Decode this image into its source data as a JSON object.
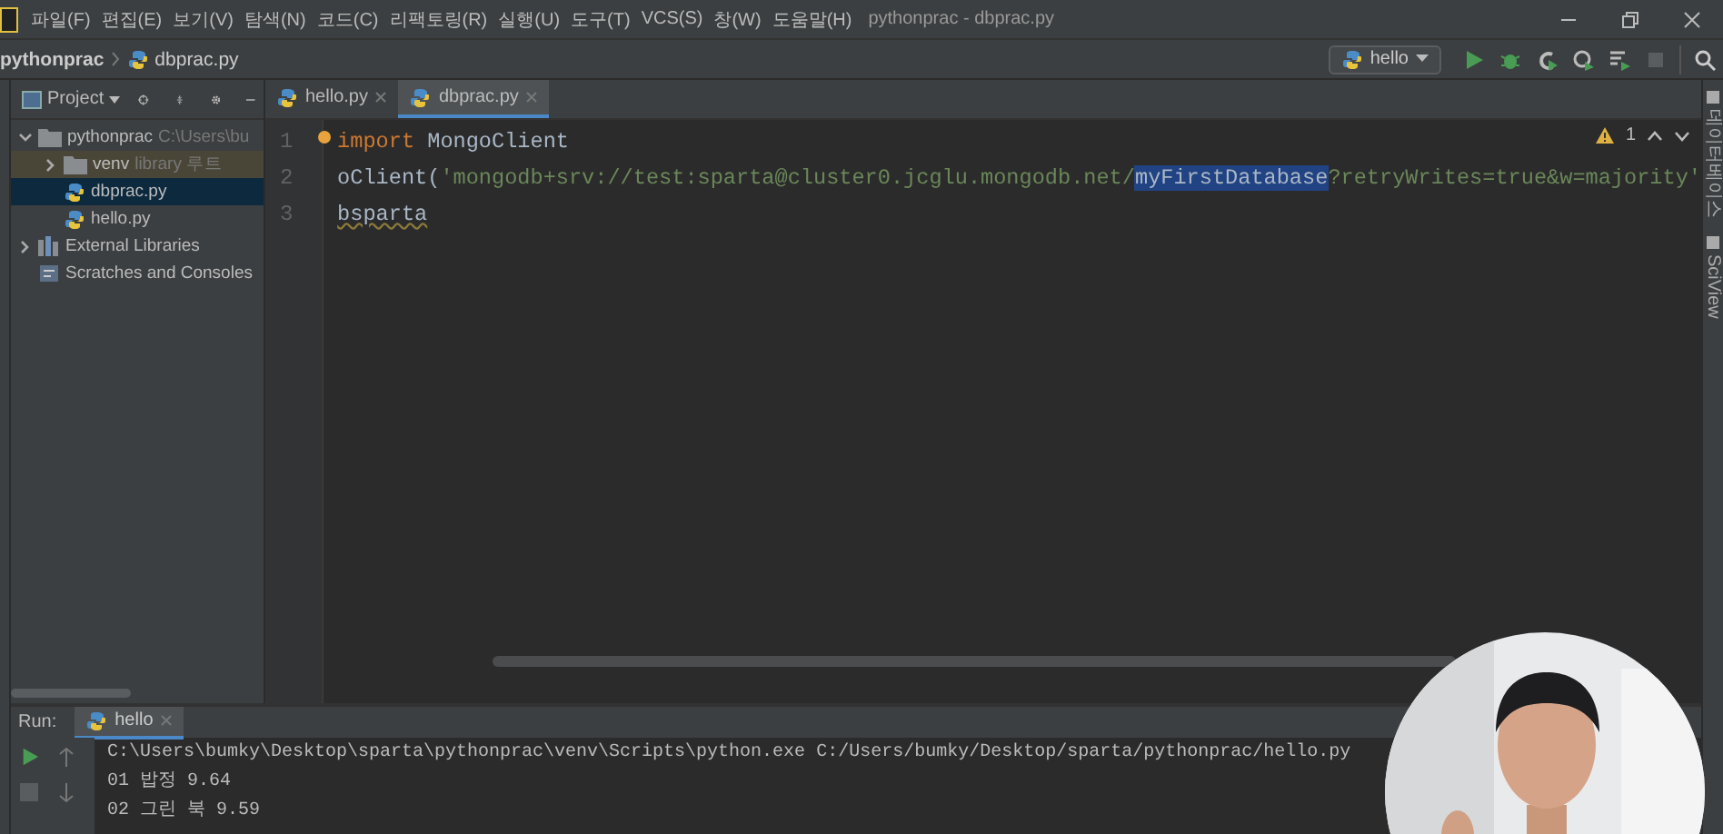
{
  "window": {
    "title": "pythonprac - dbprac.py"
  },
  "menu": [
    "파일(F)",
    "편집(E)",
    "보기(V)",
    "탐색(N)",
    "코드(C)",
    "리팩토링(R)",
    "실행(U)",
    "도구(T)",
    "VCS(S)",
    "창(W)",
    "도움말(H)"
  ],
  "breadcrumb": [
    {
      "label": "pythonprac",
      "kind": "folder"
    },
    {
      "label": "dbprac.py",
      "kind": "file"
    }
  ],
  "run_config": {
    "label": "hello"
  },
  "project_panel": {
    "label": "Project"
  },
  "tree": [
    {
      "label": "pythonprac",
      "hint": "C:\\Users\\bu",
      "kind": "folder",
      "expanded": true,
      "selected": false,
      "children": [
        {
          "label": "venv",
          "hint": "library 루트",
          "kind": "folder",
          "expanded": false,
          "selected": false,
          "highlighted": true
        },
        {
          "label": "dbprac.py",
          "kind": "file",
          "selected": true
        },
        {
          "label": "hello.py",
          "kind": "file",
          "selected": false
        }
      ]
    },
    {
      "label": "External Libraries",
      "kind": "library",
      "expanded": false,
      "selected": false
    },
    {
      "label": "Scratches and Consoles",
      "kind": "scratch",
      "selected": false
    }
  ],
  "tabs": [
    {
      "label": "hello.py",
      "selected": false
    },
    {
      "label": "dbprac.py",
      "selected": true
    }
  ],
  "editor": {
    "warnings": "1",
    "lines": [
      {
        "number": "1",
        "tokens": [
          {
            "text": "import",
            "kind": "keyword"
          },
          {
            "text": " MongoClient",
            "kind": "plain"
          }
        ]
      },
      {
        "number": "2",
        "tokens": [
          {
            "text": "oClient(",
            "kind": "plain"
          },
          {
            "text": "'mongodb+srv://test:sparta@cluster0.jcglu.mongodb.net/",
            "kind": "string"
          },
          {
            "text": "myFirstDatabase",
            "kind": "selected"
          },
          {
            "text": "?retryWrites=true&w=majority'",
            "kind": "string"
          }
        ]
      },
      {
        "number": "3",
        "tokens": [
          {
            "text": "bsparta",
            "kind": "warning"
          }
        ]
      }
    ]
  },
  "side_tools": [
    "데이터베이스",
    "SciView"
  ],
  "run_panel": {
    "label": "Run:",
    "tab": "hello",
    "lines": [
      "C:\\Users\\bumky\\Desktop\\sparta\\pythonprac\\venv\\Scripts\\python.exe C:/Users/bumky/Desktop/sparta/pythonprac/hello.py",
      "01 밥정 9.64",
      "02 그린 북 9.59"
    ]
  },
  "webcam": {
    "kind": "picture"
  }
}
